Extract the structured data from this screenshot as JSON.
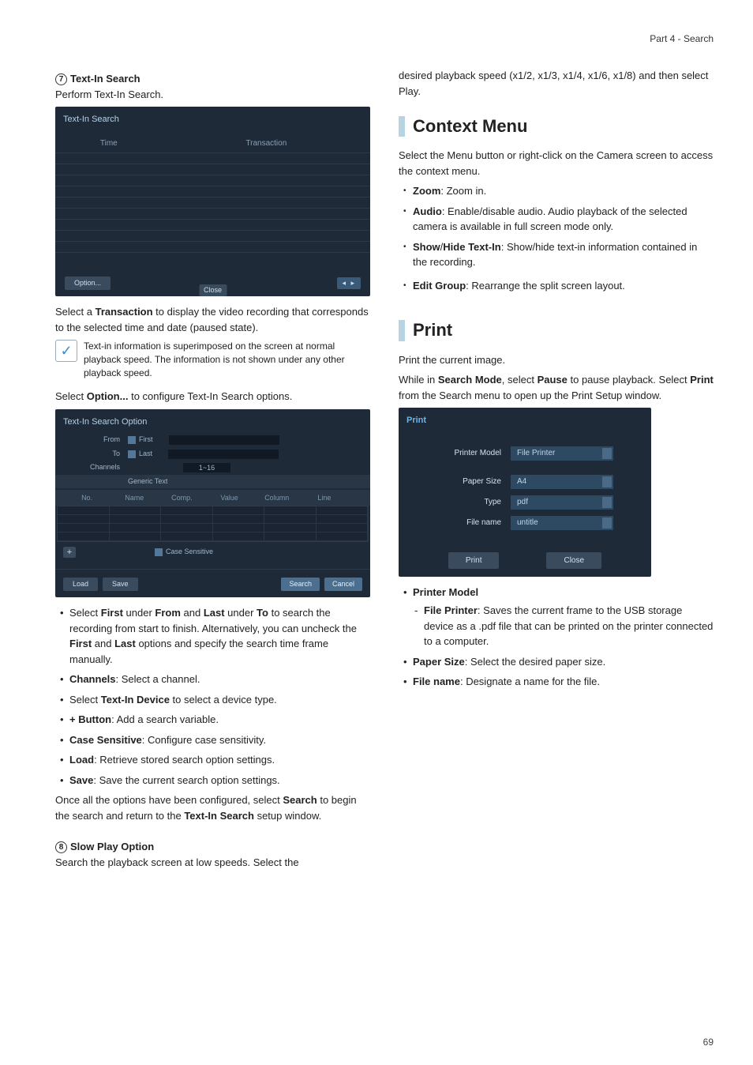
{
  "header": {
    "part_label": "Part 4 - Search"
  },
  "left": {
    "sec7": {
      "num": "7",
      "title": "Text-In Search",
      "sub": "Perform Text-In Search.",
      "panel": {
        "title": "Text-In Search",
        "col1": "Time",
        "col2": "Transaction",
        "option_btn": "Option...",
        "close_btn": "Close"
      },
      "after1a": "Select a ",
      "after1b": "Transaction",
      "after1c": " to display the video recording that corresponds to the selected time and date (paused state).",
      "note": "Text-in information is superimposed on the screen at normal playback speed. The information is not shown under any other playback speed.",
      "opt_intro_a": "Select ",
      "opt_intro_b": "Option...",
      "opt_intro_c": " to configure Text-In Search options.",
      "opt_panel": {
        "title": "Text-In Search Option",
        "from": "From",
        "first": "First",
        "to": "To",
        "last": "Last",
        "channels": "Channels",
        "range": "1~16",
        "device": "Generic Text",
        "h_no": "No.",
        "h_name": "Name",
        "h_comp": "Comp.",
        "h_value": "Value",
        "h_column": "Column",
        "h_line": "Line",
        "plus": "+",
        "case": "Case Sensitive",
        "load": "Load",
        "save": "Save",
        "search": "Search",
        "cancel": "Cancel"
      },
      "bullets": [
        {
          "pre": "Select ",
          "b1": "First",
          "mid1": " under ",
          "b2": "From",
          "mid2": " and ",
          "b3": "Last",
          "mid3": " under ",
          "b4": "To",
          "mid4": " to search the recording from start to finish. Alternatively, you can uncheck the ",
          "b5": "First",
          "mid5": " and ",
          "b6": "Last",
          "mid6": " options and specify the search time frame manually."
        },
        {
          "b1": "Channels",
          "tail": ": Select a channel."
        },
        {
          "pre": "Select ",
          "b1": "Text-In Device",
          "tail": " to select a device type."
        },
        {
          "b1": "+ Button",
          "tail": ": Add a search variable."
        },
        {
          "b1": "Case Sensitive",
          "tail": ": Configure case sensitivity."
        },
        {
          "b1": "Load",
          "tail": ": Retrieve stored search option settings."
        },
        {
          "b1": "Save",
          "tail": ": Save the current search option settings."
        }
      ],
      "closing_a": "Once all the options have been configured, select ",
      "closing_b": "Search",
      "closing_c": " to begin the search and return to the ",
      "closing_d": "Text-In Search",
      "closing_e": " setup window."
    },
    "sec8": {
      "num": "8",
      "title": "Slow Play Option",
      "sub": "Search the playback screen at low speeds. Select the"
    }
  },
  "right": {
    "slow_cont": "desired playback speed (x1/2, x1/3, x1/4, x1/6, x1/8) and then select Play.",
    "context": {
      "title": "Context Menu",
      "intro": "Select the Menu button or right-click on the Camera screen to access the context menu.",
      "items": [
        {
          "b": "Zoom",
          "t": ": Zoom in."
        },
        {
          "b": "Audio",
          "t": ": Enable/disable audio. Audio playback of the selected camera is available in full screen mode only."
        },
        {
          "b": "Show",
          "m": "/",
          "b2": "Hide Text-In",
          "t": ": Show/hide text-in information contained in the recording."
        },
        {
          "b": "Edit Group",
          "t": ": Rearrange the split screen layout."
        }
      ]
    },
    "print": {
      "title": "Print",
      "p1": "Print the current image.",
      "p2a": "While in ",
      "p2b": "Search Mode",
      "p2c": ", select ",
      "p2d": "Pause",
      "p2e": " to pause playback. Select ",
      "p2f": "Print",
      "p2g": " from the Search menu to open up the Print Setup window.",
      "panel": {
        "title": "Print",
        "printer_model": "Printer Model",
        "printer_model_v": "File Printer",
        "paper_size": "Paper Size",
        "paper_size_v": "A4",
        "type": "Type",
        "type_v": "pdf",
        "file_name": "File name",
        "file_name_v": "untitle",
        "print_btn": "Print",
        "close_btn": "Close"
      },
      "bul": {
        "pm": "Printer Model",
        "fp_b": "File Printer",
        "fp_t": ": Saves the current frame to the USB storage device as a .pdf file that can be printed on the printer connected to a computer.",
        "ps_b": "Paper Size",
        "ps_t": ": Select the desired paper size.",
        "fn_b": "File name",
        "fn_t": ": Designate a name for the file."
      }
    }
  },
  "page_num": "69"
}
